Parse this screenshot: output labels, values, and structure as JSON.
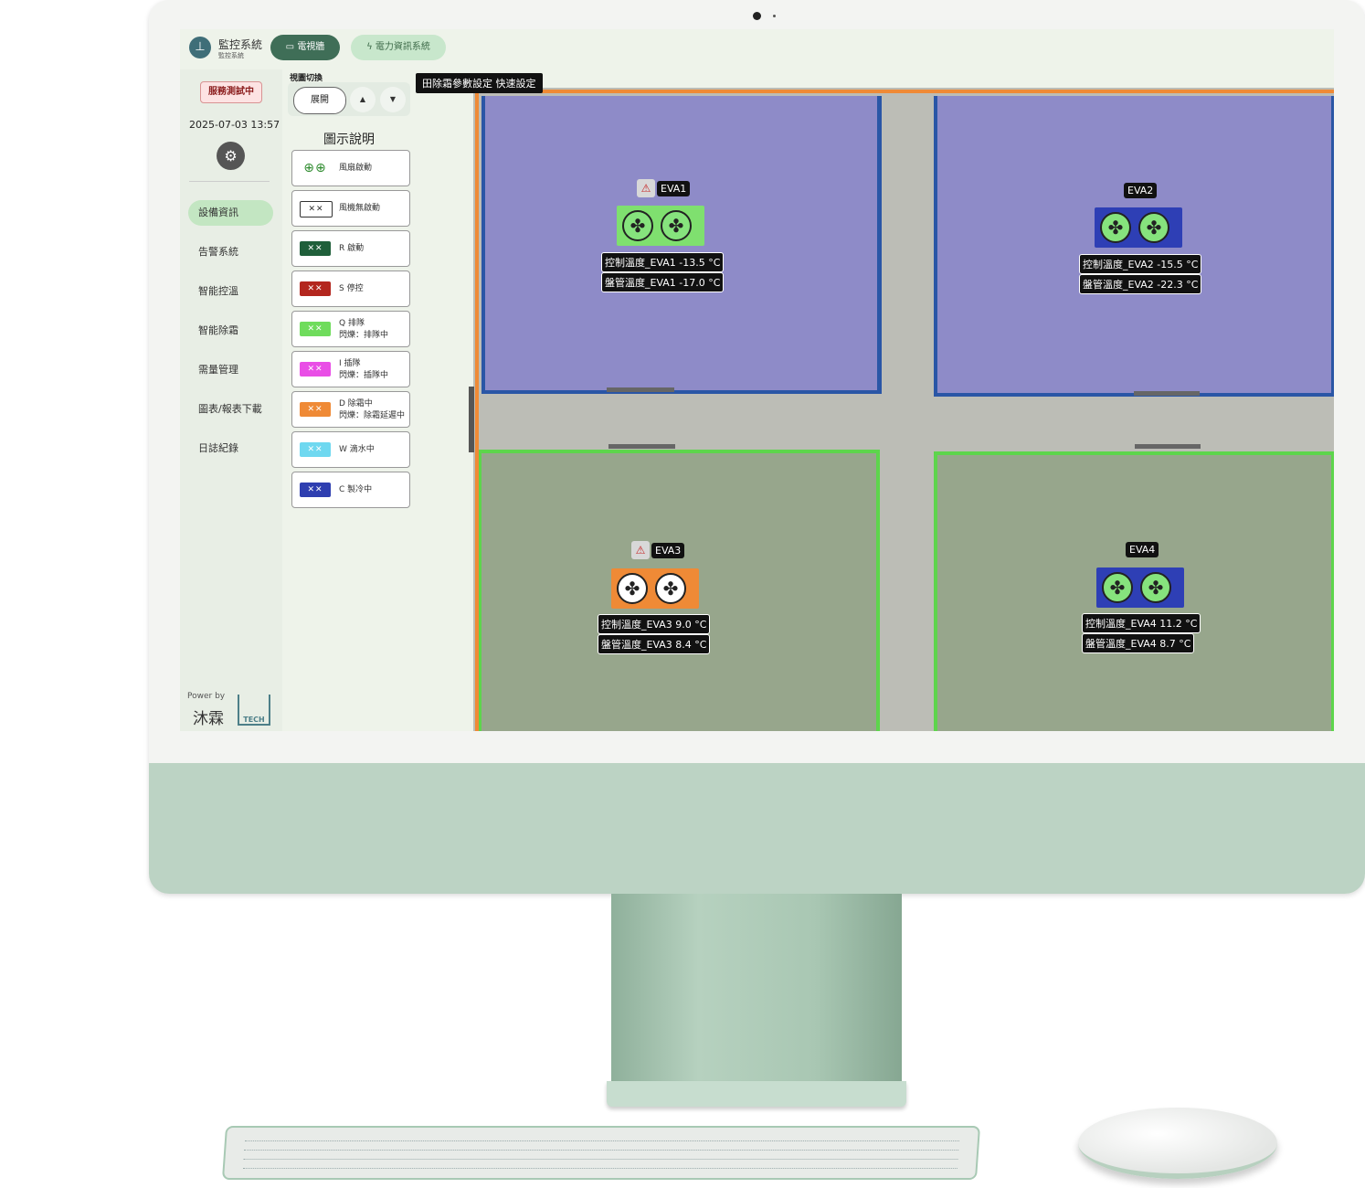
{
  "app": {
    "title": "監控系統",
    "subtitle": "監控系統",
    "tabs": [
      {
        "label": "電視牆",
        "icon": "monitor-icon"
      },
      {
        "label": "電力資訊系統",
        "icon": "lightning-icon"
      }
    ]
  },
  "sidebar": {
    "service_badge": "服務測試中",
    "datetime": "2025-07-03 13:57",
    "nav": [
      "設備資訊",
      "告警系統",
      "智能控溫",
      "智能除霜",
      "需量管理",
      "圖表/報表下載",
      "日誌紀錄"
    ],
    "active_index": 0,
    "power_by": "Power by",
    "brand": "沐霖",
    "brand_tech": "TECH"
  },
  "view_switch": {
    "label": "視圖切換",
    "expand": "展開",
    "up": "▲",
    "down": "▼"
  },
  "legend": {
    "title": "圖示說明",
    "items": [
      {
        "line1": "風扇啟動",
        "line2": "",
        "color": "#6fdc5c"
      },
      {
        "line1": "風機無啟動",
        "line2": "",
        "color": "#ffffff"
      },
      {
        "line1": "R 啟動",
        "line2": "",
        "color": "#1f5f3a"
      },
      {
        "line1": "S 停控",
        "line2": "",
        "color": "#b3261e"
      },
      {
        "line1": "Q 排隊",
        "line2": "閃爍：排隊中",
        "color": "#6fdc5c"
      },
      {
        "line1": "I 插隊",
        "line2": "閃爍：插隊中",
        "color": "#e94ee6"
      },
      {
        "line1": "D 除霜中",
        "line2": "閃爍：除霜延遲中",
        "color": "#ef8a36"
      },
      {
        "line1": "W 滴水中",
        "line2": "",
        "color": "#6fd8f0"
      },
      {
        "line1": "C 製冷中",
        "line2": "",
        "color": "#2f3fb0"
      }
    ]
  },
  "tooltip": "田除霜參數設定 快速設定",
  "units": [
    {
      "name": "EVA1",
      "warning": true,
      "color": "#7fe06f",
      "fan_color": "green",
      "ctrl_label": "控制溫度_EVA1",
      "ctrl_value": "-13.5",
      "coil_label": "盤管溫度_EVA1",
      "coil_value": "-17.0",
      "unit": "°C"
    },
    {
      "name": "EVA2",
      "warning": false,
      "color": "#2e3fb5",
      "fan_color": "green",
      "ctrl_label": "控制溫度_EVA2",
      "ctrl_value": "-15.5",
      "coil_label": "盤管溫度_EVA2",
      "coil_value": "-22.3",
      "unit": "°C"
    },
    {
      "name": "EVA3",
      "warning": true,
      "color": "#ef8a36",
      "fan_color": "white",
      "ctrl_label": "控制溫度_EVA3",
      "ctrl_value": "9.0",
      "coil_label": "盤管溫度_EVA3",
      "coil_value": "8.4",
      "unit": "°C"
    },
    {
      "name": "EVA4",
      "warning": false,
      "color": "#2e3fb5",
      "fan_color": "green",
      "ctrl_label": "控制溫度_EVA4",
      "ctrl_value": "11.2",
      "coil_label": "盤管溫度_EVA4",
      "coil_value": "8.7",
      "unit": "°C"
    }
  ]
}
